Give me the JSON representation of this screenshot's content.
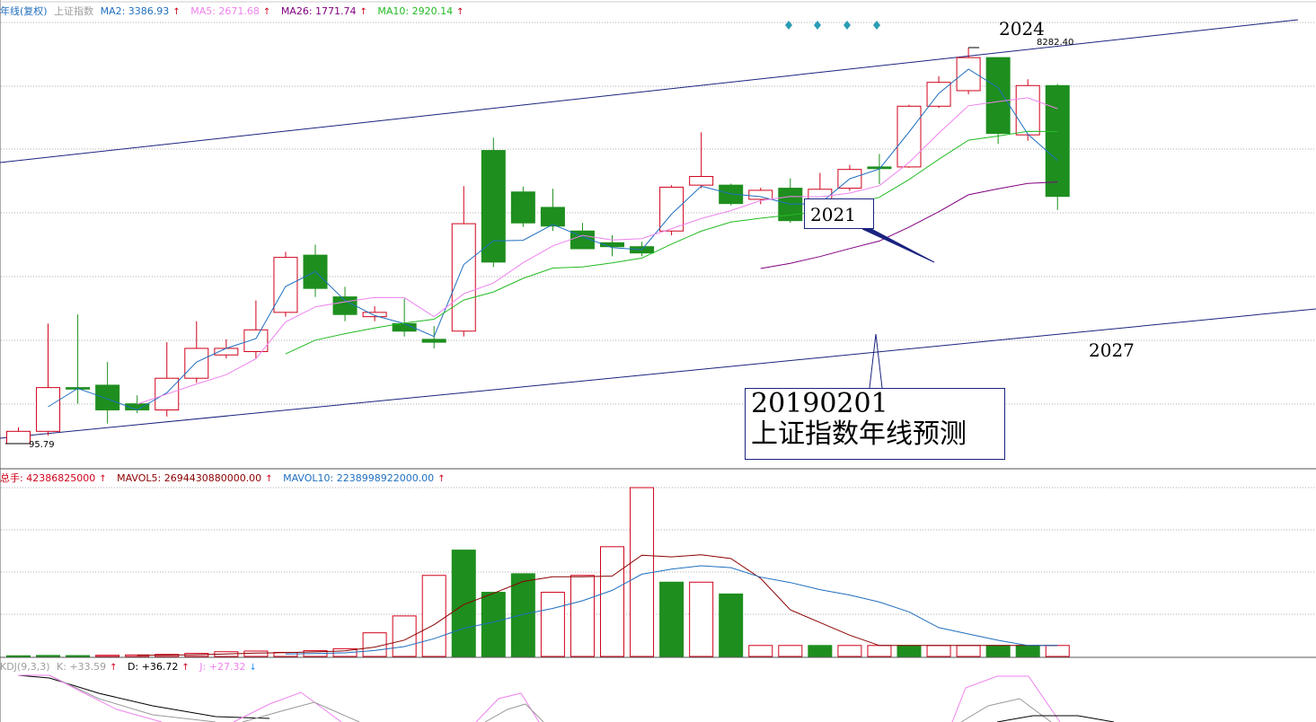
{
  "price_header": {
    "name": "年线(复权)",
    "index": "上证指数",
    "ma2": "MA2: 3386.93",
    "ma5": "MA5: 2671.68",
    "ma26": "MA26: 1771.74",
    "ma10": "MA10: 2920.14"
  },
  "volume_header": {
    "total": "总手: 42386825000",
    "mavol5": "MAVOL5: 2694430880000.00",
    "mavol10": "MAVOL10: 2238998922000.00"
  },
  "kdj_header": {
    "name": "KDJ(9,3,3)",
    "k": "K: +33.59",
    "d": "D: +36.72",
    "j": "J: +27.32"
  },
  "annotations": {
    "callout_big_line1": "20190201",
    "callout_big_line2": "上证指数年线预测",
    "callout_small": "2021",
    "label_2024": "2024",
    "label_2027": "2027",
    "high_label": "8282.40",
    "low_label": "95.79"
  },
  "colors": {
    "up": "#d0021b",
    "down": "#1e8e1e",
    "ma2": "#1f6fbf",
    "ma5": "#ee82ee",
    "ma26": "#800080",
    "ma10": "#22bb22",
    "channel": "#1a237e",
    "grid": "#b0b0b0"
  },
  "chart_data": {
    "type": "candlestick",
    "price_scale_note": "approximate index levels estimated from pixel positions",
    "candles": [
      {
        "o": 95.79,
        "c": 110,
        "h": 115,
        "l": 95.79,
        "up": true
      },
      {
        "o": 110,
        "c": 180,
        "h": 370,
        "l": 105,
        "up": true
      },
      {
        "o": 180,
        "c": 177,
        "h": 410,
        "l": 150,
        "up": false
      },
      {
        "o": 185,
        "c": 140,
        "h": 240,
        "l": 120,
        "up": false
      },
      {
        "o": 150,
        "c": 140,
        "h": 165,
        "l": 135,
        "up": false
      },
      {
        "o": 140,
        "c": 200,
        "h": 300,
        "l": 130,
        "up": true
      },
      {
        "o": 200,
        "c": 280,
        "h": 380,
        "l": 190,
        "up": true
      },
      {
        "o": 260,
        "c": 280,
        "h": 310,
        "l": 250,
        "up": true
      },
      {
        "o": 270,
        "c": 345,
        "h": 480,
        "l": 250,
        "up": true
      },
      {
        "o": 420,
        "c": 780,
        "h": 830,
        "l": 400,
        "up": true
      },
      {
        "o": 800,
        "c": 550,
        "h": 900,
        "l": 500,
        "up": false
      },
      {
        "o": 500,
        "c": 410,
        "h": 560,
        "l": 380,
        "up": false
      },
      {
        "o": 420,
        "c": 400,
        "h": 450,
        "l": 380,
        "up": true
      },
      {
        "o": 370,
        "c": 340,
        "h": 490,
        "l": 320,
        "up": false
      },
      {
        "o": 310,
        "c": 300,
        "h": 360,
        "l": 280,
        "up": false
      },
      {
        "o": 340,
        "c": 1140,
        "h": 1740,
        "l": 320,
        "up": true
      },
      {
        "o": 2600,
        "c": 740,
        "h": 3000,
        "l": 700,
        "up": false
      },
      {
        "o": 1630,
        "c": 1150,
        "h": 1730,
        "l": 1100,
        "up": false
      },
      {
        "o": 1370,
        "c": 1110,
        "h": 1690,
        "l": 1050,
        "up": false
      },
      {
        "o": 1050,
        "c": 860,
        "h": 1150,
        "l": 860,
        "up": false
      },
      {
        "o": 920,
        "c": 880,
        "h": 1000,
        "l": 790,
        "up": false
      },
      {
        "o": 880,
        "c": 820,
        "h": 930,
        "l": 790,
        "up": false
      },
      {
        "o": 1050,
        "c": 1720,
        "h": 1760,
        "l": 1000,
        "up": true
      },
      {
        "o": 1940,
        "c": 1760,
        "h": 3190,
        "l": 1700,
        "up": true
      },
      {
        "o": 1760,
        "c": 1430,
        "h": 1790,
        "l": 1400,
        "up": false
      },
      {
        "o": 1500,
        "c": 1660,
        "h": 1710,
        "l": 1420,
        "up": true
      },
      {
        "o": 1700,
        "c": 1180,
        "h": 1900,
        "l": 1150,
        "up": false
      },
      {
        "o": 1180,
        "c": 1680,
        "h": 2020,
        "l": 1150,
        "up": true
      },
      {
        "o": 1700,
        "c": 2100,
        "h": 2210,
        "l": 1650,
        "up": true
      },
      {
        "o": 2160,
        "c": 2120,
        "h": 2500,
        "l": 1780,
        "up": false
      },
      {
        "o": 2160,
        "c": 4280,
        "h": 4350,
        "l": 2140,
        "up": true
      },
      {
        "o": 4280,
        "c": 5600,
        "h": 6000,
        "l": 4200,
        "up": true
      },
      {
        "o": 5100,
        "c": 7400,
        "h": 8282.4,
        "l": 4900,
        "up": true
      },
      {
        "o": 7400,
        "c": 3150,
        "h": 7400,
        "l": 2800,
        "up": false
      },
      {
        "o": 5400,
        "c": 3100,
        "h": 5800,
        "l": 2900,
        "up": true
      },
      {
        "o": 5400,
        "c": 1550,
        "h": 5500,
        "l": 1330,
        "up": false
      }
    ],
    "volume": {
      "bars": [
        0.4,
        0.6,
        0.5,
        0.7,
        0.9,
        1.2,
        1.8,
        2.8,
        3.2,
        2.4,
        3.4,
        4.6,
        14.0,
        24.0,
        48.0,
        63.0,
        38.0,
        49.0,
        38.0,
        48.0,
        65.0,
        100.0,
        44.0,
        44.0,
        37.0,
        6.5,
        6.5,
        6.5,
        6.5,
        6.5,
        6.5,
        6.5,
        6.5,
        6.5,
        6.5,
        6.5
      ],
      "up": [
        false,
        false,
        false,
        true,
        true,
        true,
        true,
        true,
        true,
        true,
        true,
        true,
        true,
        true,
        true,
        false,
        false,
        false,
        true,
        true,
        true,
        true,
        false,
        true,
        false,
        true,
        true,
        false,
        true,
        true,
        false,
        true,
        true,
        false,
        false,
        true
      ]
    }
  }
}
